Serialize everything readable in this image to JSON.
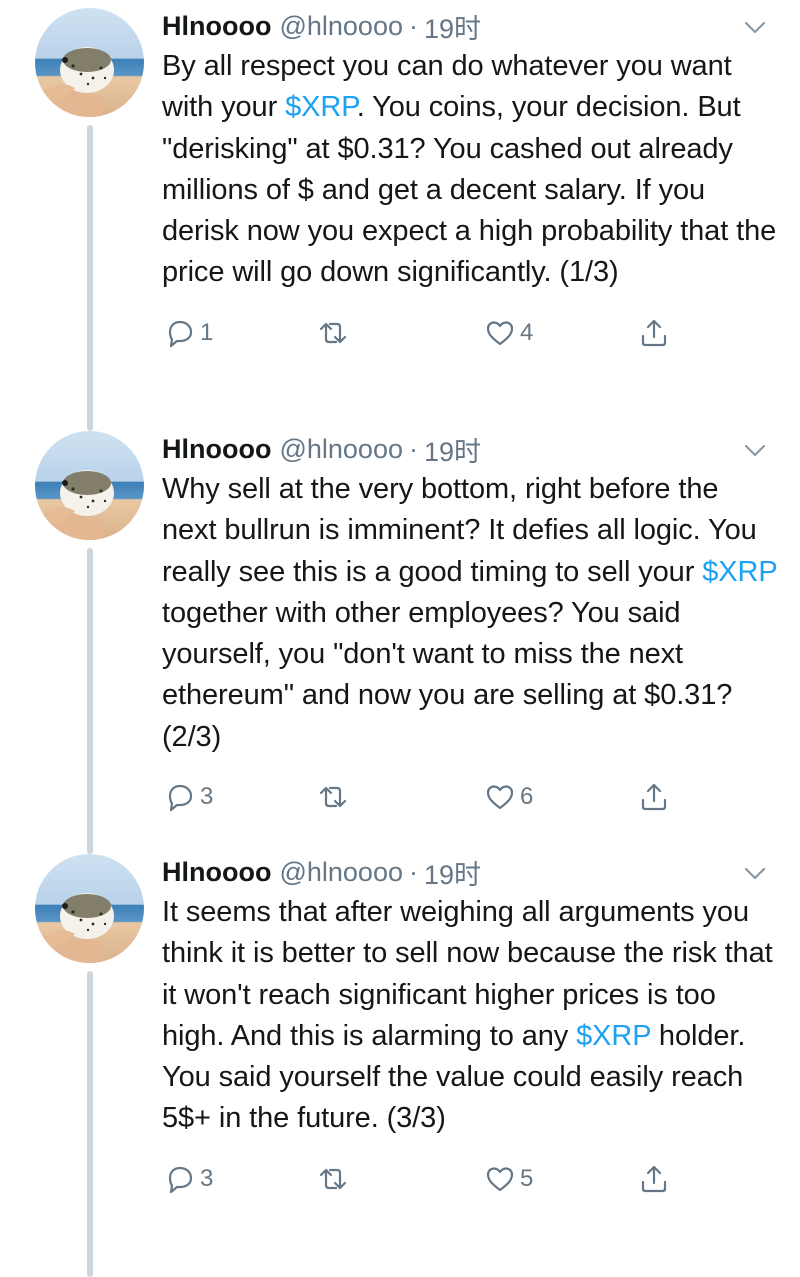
{
  "tweets": [
    {
      "name": "Hlnoooo",
      "handle": "@hlnoooo",
      "separator": "·",
      "time": "19时",
      "segments": [
        {
          "text": "By all respect you can do whatever you want with your "
        },
        {
          "text": "$XRP",
          "cashtag": true
        },
        {
          "text": ". You coins, your decision. But \"derisking\" at $0.31? You cashed out already millions of $ and get a decent salary. If you derisk now you expect a high probability that the price will go down significantly. (1/3)"
        }
      ],
      "replies": "1",
      "retweets": "",
      "likes": "4"
    },
    {
      "name": "Hlnoooo",
      "handle": "@hlnoooo",
      "separator": "·",
      "time": "19时",
      "segments": [
        {
          "text": "Why sell at the very bottom, right before the next bullrun is imminent? It defies all logic. You really see this is a good timing to sell your "
        },
        {
          "text": "$XRP",
          "cashtag": true
        },
        {
          "text": " together with other employees? You said yourself, you \"don't want to miss the next ethereum\" and now you are selling at $0.31? (2/3)"
        }
      ],
      "replies": "3",
      "retweets": "",
      "likes": "6"
    },
    {
      "name": "Hlnoooo",
      "handle": "@hlnoooo",
      "separator": "·",
      "time": "19时",
      "segments": [
        {
          "text": "It seems that after weighing all arguments you think it is better to sell now because the risk that it won't reach significant higher prices is too high. And this is alarming to any "
        },
        {
          "text": "$XRP",
          "cashtag": true
        },
        {
          "text": " holder. You said yourself the value could easily reach 5$+ in the future. (3/3)"
        }
      ],
      "replies": "3",
      "retweets": "",
      "likes": "5"
    }
  ],
  "icons": {
    "reply": "reply-icon",
    "retweet": "retweet-icon",
    "like": "heart-icon",
    "share": "share-icon",
    "menu": "chevron-down-icon",
    "avatar": "pufferfish-avatar"
  },
  "colors": {
    "cashtag": "#1da1f2",
    "muted": "#657786",
    "text": "#14171a",
    "thread_line": "#cdd6dd"
  }
}
